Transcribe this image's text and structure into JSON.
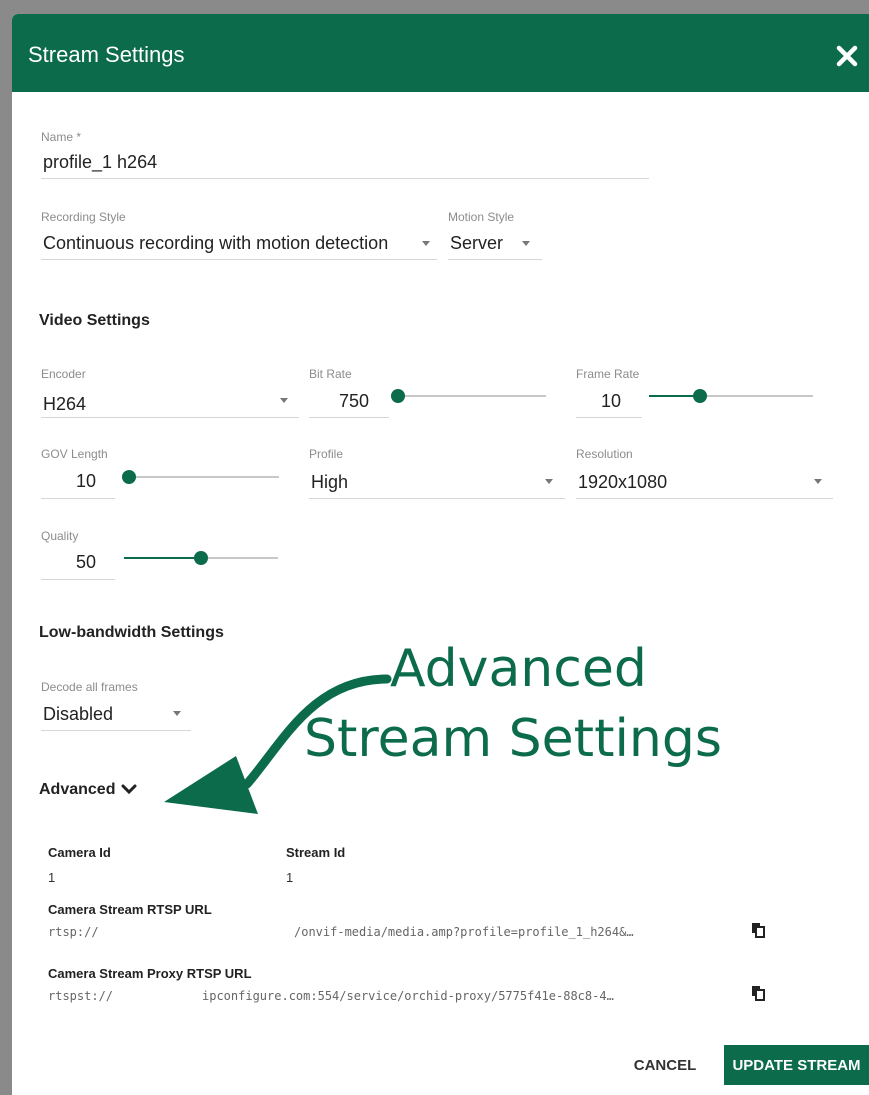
{
  "dialog": {
    "title": "Stream Settings",
    "close_icon": "close-icon",
    "accent_color": "#0b6b4a"
  },
  "name": {
    "label": "Name *",
    "value": "profile_1 h264"
  },
  "recording_style": {
    "label": "Recording Style",
    "value": "Continuous recording with motion detection"
  },
  "motion_style": {
    "label": "Motion Style",
    "value": "Server"
  },
  "video_settings": {
    "title": "Video Settings",
    "encoder": {
      "label": "Encoder",
      "value": "H264"
    },
    "bit_rate": {
      "label": "Bit Rate",
      "value": "750",
      "slider_fraction": 0.0
    },
    "frame_rate": {
      "label": "Frame Rate",
      "value": "10",
      "slider_fraction": 0.31
    },
    "gov_length": {
      "label": "GOV Length",
      "value": "10",
      "slider_fraction": 0.0
    },
    "profile": {
      "label": "Profile",
      "value": "High"
    },
    "resolution": {
      "label": "Resolution",
      "value": "1920x1080"
    },
    "quality": {
      "label": "Quality",
      "value": "50",
      "slider_fraction": 0.5
    }
  },
  "low_bandwidth": {
    "title": "Low-bandwidth Settings",
    "decode_all_frames": {
      "label": "Decode all frames",
      "value": "Disabled"
    }
  },
  "advanced": {
    "title": "Advanced",
    "camera_id": {
      "label": "Camera Id",
      "value": "1"
    },
    "stream_id": {
      "label": "Stream Id",
      "value": "1"
    },
    "rtsp_url": {
      "label": "Camera Stream RTSP URL",
      "prefix": "rtsp://",
      "suffix": "/onvif-media/media.amp?profile=profile_1_h264&…"
    },
    "proxy_url": {
      "label": "Camera Stream Proxy RTSP URL",
      "prefix": "rtspst://",
      "suffix": "ipconfigure.com:554/service/orchid-proxy/5775f41e-88c8-4…"
    }
  },
  "annotation": {
    "line1": "Advanced",
    "line2": "Stream Settings"
  },
  "buttons": {
    "cancel": "CANCEL",
    "update": "UPDATE STREAM"
  }
}
